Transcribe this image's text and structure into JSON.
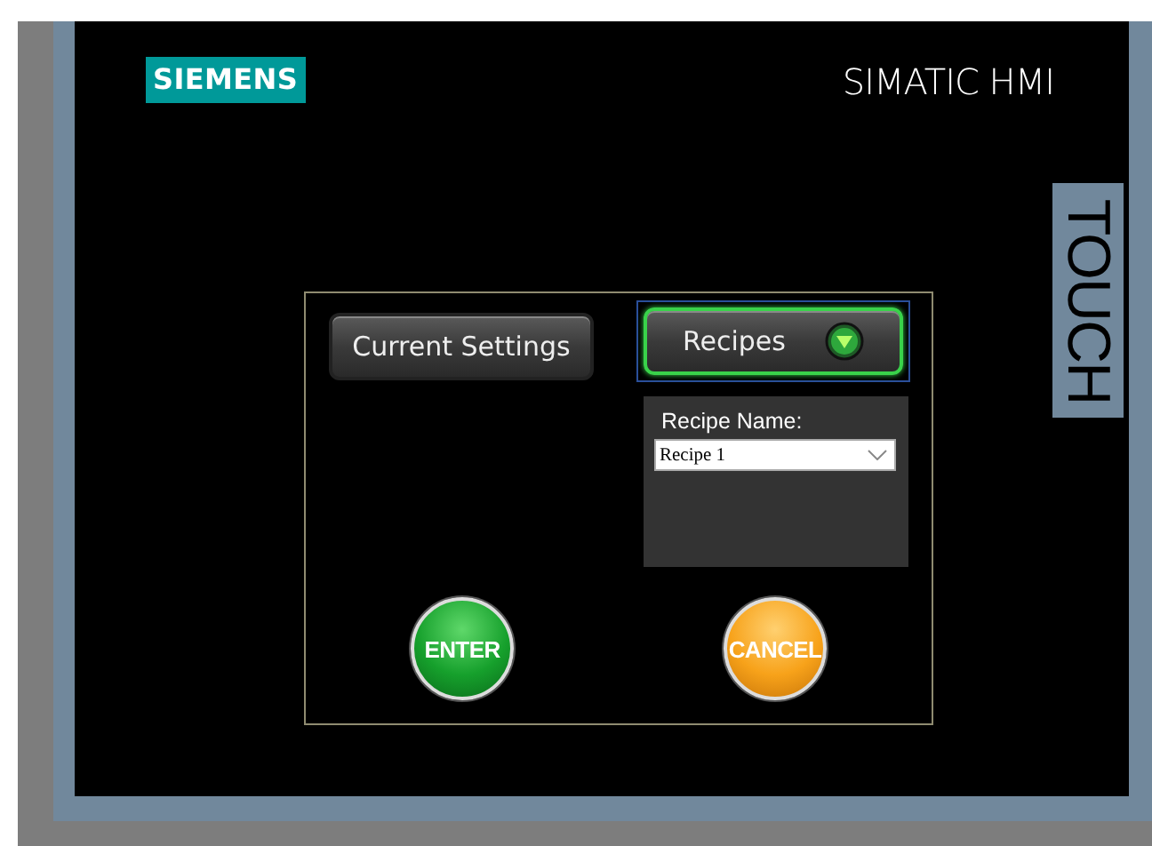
{
  "header": {
    "logo": "SIEMENS",
    "product": "SIMATIC HMI",
    "badge": "TOUCH"
  },
  "nav_buttons": [
    {
      "label": "Current Settings",
      "selected": false,
      "kind": "plain"
    },
    {
      "label": "Recipes",
      "selected": true,
      "kind": "dropdown"
    }
  ],
  "recipe_panel": {
    "label": "Recipe Name:",
    "value": "Recipe 1"
  },
  "action_buttons": [
    {
      "label": "ENTER",
      "kind": "confirm"
    },
    {
      "label": "CANCEL",
      "kind": "cancel"
    }
  ]
}
